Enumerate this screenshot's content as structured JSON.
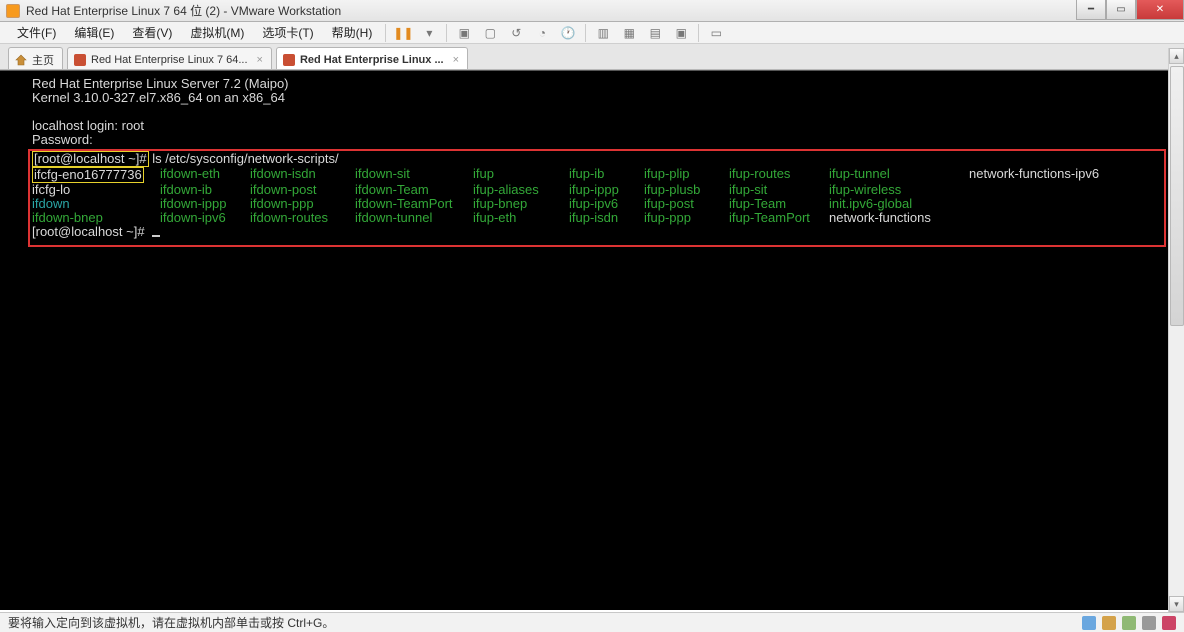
{
  "window": {
    "title": "Red Hat Enterprise Linux 7 64 位 (2) - VMware Workstation"
  },
  "menu": {
    "file": "文件(F)",
    "edit": "编辑(E)",
    "view": "查看(V)",
    "vm": "虚拟机(M)",
    "tabs": "选项卡(T)",
    "help": "帮助(H)"
  },
  "tabs": {
    "home": "主页",
    "t1": "Red Hat Enterprise Linux 7 64...",
    "t2": "Red Hat Enterprise Linux ..."
  },
  "terminal": {
    "banner1": "Red Hat Enterprise Linux Server 7.2 (Maipo)",
    "banner2": "Kernel 3.10.0-327.el7.x86_64 on an x86_64",
    "loginPrompt": "localhost login: root",
    "password": "Password:",
    "prompt": "[root@localhost ~]#",
    "cmd": "ls /etc/sysconfig/network-scripts/",
    "listing": [
      [
        "ifcfg-eno16777736",
        "ifdown-eth",
        "ifdown-isdn",
        "ifdown-sit",
        "ifup",
        "ifup-ib",
        "ifup-plip",
        "ifup-routes",
        "ifup-tunnel",
        "network-functions-ipv6"
      ],
      [
        "ifcfg-lo",
        "ifdown-ib",
        "ifdown-post",
        "ifdown-Team",
        "ifup-aliases",
        "ifup-ippp",
        "ifup-plusb",
        "ifup-sit",
        "ifup-wireless",
        ""
      ],
      [
        "ifdown",
        "ifdown-ippp",
        "ifdown-ppp",
        "ifdown-TeamPort",
        "ifup-bnep",
        "ifup-ipv6",
        "ifup-post",
        "ifup-Team",
        "init.ipv6-global",
        ""
      ],
      [
        "ifdown-bnep",
        "ifdown-ipv6",
        "ifdown-routes",
        "ifdown-tunnel",
        "ifup-eth",
        "ifup-isdn",
        "ifup-ppp",
        "ifup-TeamPort",
        "network-functions",
        ""
      ]
    ],
    "colors": [
      [
        "h",
        "g",
        "g",
        "g",
        "g",
        "g",
        "g",
        "g",
        "g",
        "w"
      ],
      [
        "w",
        "g",
        "g",
        "g",
        "g",
        "g",
        "g",
        "g",
        "g",
        ""
      ],
      [
        "c",
        "g",
        "g",
        "g",
        "g",
        "g",
        "g",
        "g",
        "g",
        ""
      ],
      [
        "g",
        "g",
        "g",
        "g",
        "g",
        "g",
        "g",
        "g",
        "w",
        ""
      ]
    ]
  },
  "status": {
    "text": "要将输入定向到该虚拟机，请在虚拟机内部单击或按 Ctrl+G。"
  }
}
